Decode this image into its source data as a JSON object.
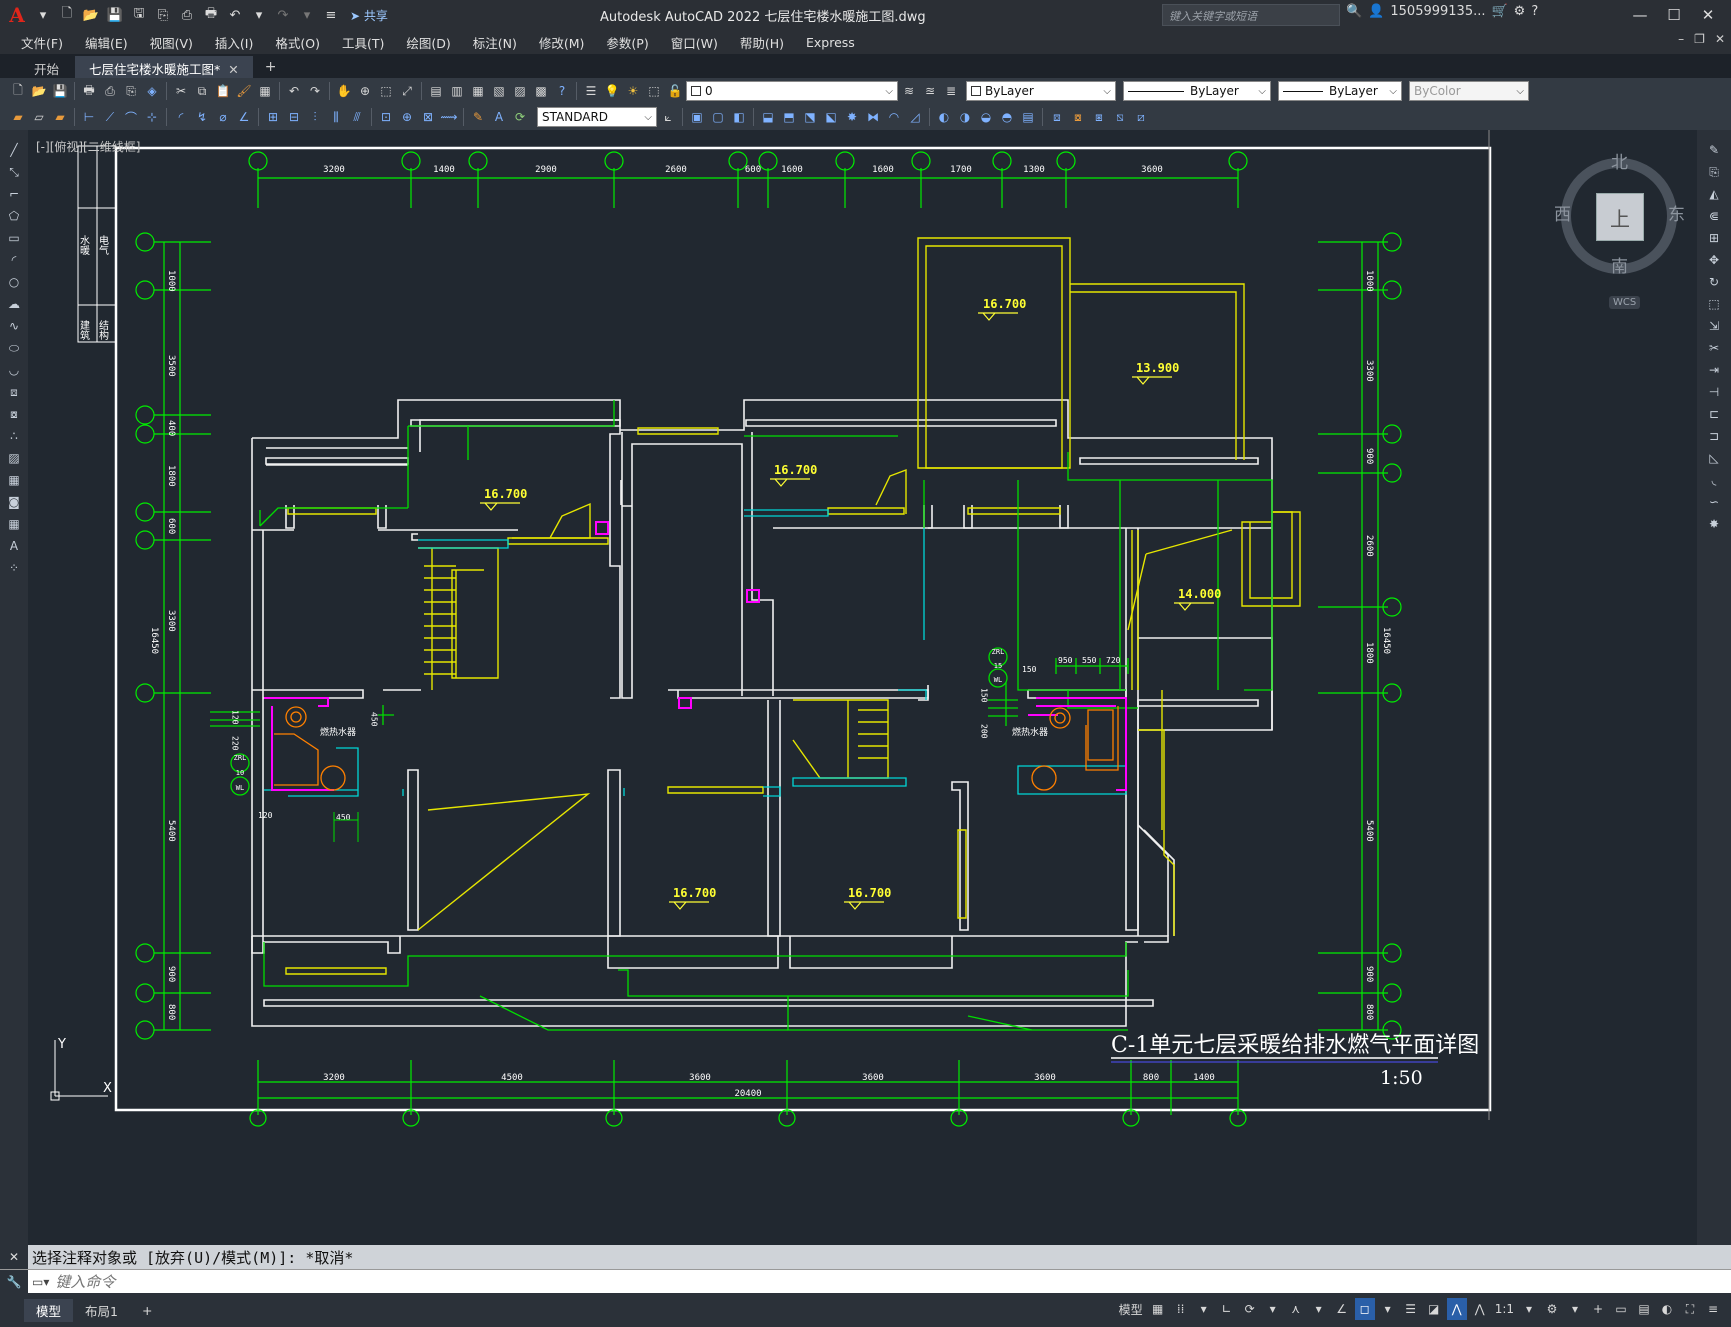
{
  "app": {
    "window_title": "Autodesk AutoCAD 2022    七层住宅楼水暖施工图.dwg",
    "share_label": "共享",
    "search_placeholder": "键入关键字或短语",
    "user_id": "1505999135..."
  },
  "menus": [
    "文件(F)",
    "编辑(E)",
    "视图(V)",
    "插入(I)",
    "格式(O)",
    "工具(T)",
    "绘图(D)",
    "标注(N)",
    "修改(M)",
    "参数(P)",
    "窗口(W)",
    "帮助(H)",
    "Express"
  ],
  "tabs": [
    {
      "label": "开始"
    },
    {
      "label": "七层住宅楼水暖施工图*"
    }
  ],
  "layer_toolbar": {
    "layer_value": "0",
    "color_value": "ByLayer",
    "linetype_value": "ByLayer",
    "lineweight_value": "ByLayer",
    "plotstyle_value": "ByColor"
  },
  "text_style": "STANDARD",
  "viewport": {
    "label": "[-][俯视][二维线框]"
  },
  "viewcube": {
    "north": "北",
    "south": "南",
    "east": "东",
    "west": "西",
    "top": "上",
    "wcs": "WCS"
  },
  "drawing": {
    "title": "C-1单元七层采暖给排水燃气平面详图",
    "scale": "1:50",
    "top_dims": [
      "3200",
      "1400",
      "2900",
      "2600",
      "600",
      "1600",
      "1600",
      "1700",
      "1300",
      "3600"
    ],
    "bottom_dims": [
      "3200",
      "4500",
      "3600",
      "3600",
      "3600",
      "800",
      "1400"
    ],
    "bottom_total": "20400",
    "left_dims": [
      "1000",
      "3500",
      "400",
      "1800",
      "600",
      "3300",
      "5400",
      "900",
      "800"
    ],
    "right_dims": [
      "1000",
      "3300",
      "900",
      "2600",
      "1800",
      "5400",
      "900",
      "800"
    ],
    "side_total": "16450",
    "elevations": [
      "16.700",
      "16.700",
      "13.900",
      "16.700",
      "14.000",
      "16.700",
      "16.700"
    ],
    "heater_labels": [
      "燃热水器",
      "燃热水器"
    ],
    "detail_dims": [
      "120",
      "450",
      "220",
      "120",
      "450",
      "950",
      "550",
      "720",
      "150",
      "200",
      "150"
    ],
    "riser_labels": [
      "ZRL",
      "10",
      "WL",
      "ZRL",
      "15",
      "WL"
    ],
    "legend_cells": [
      "水暖",
      "电气",
      "建筑",
      "结构"
    ]
  },
  "command": {
    "history": "选择注释对象或 [放弃(U)/模式(M)]: *取消*",
    "placeholder": "键入命令"
  },
  "layout_tabs": [
    "模型",
    "布局1"
  ],
  "status": {
    "model_label": "模型",
    "annot_scale": "1:1"
  }
}
